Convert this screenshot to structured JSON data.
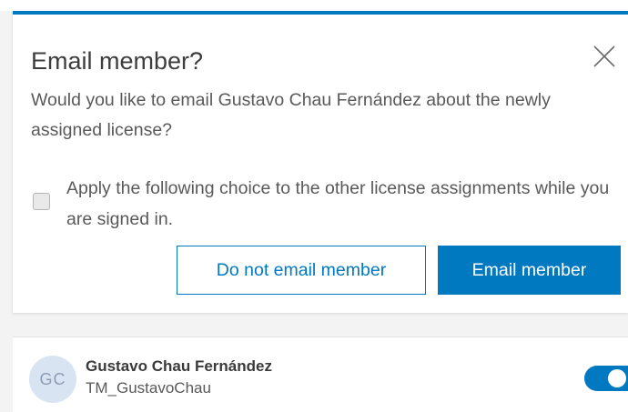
{
  "dialog": {
    "title": "Email member?",
    "message": "Would you like to email Gustavo Chau Fernández about the newly assigned license?",
    "checkbox": {
      "label": "Apply the following choice to the other license assignments while you are signed in.",
      "checked": false
    },
    "secondary_button_label": "Do not email member",
    "primary_button_label": "Email member",
    "close_icon": "close-icon"
  },
  "member": {
    "initials": "GC",
    "name": "Gustavo Chau Fernández",
    "username": "TM_GustavoChau",
    "toggle_on": true
  },
  "colors": {
    "accent": "#0079c1",
    "avatar_bg": "#d9e4f2",
    "avatar_text": "#8e9db3",
    "text": "#595959"
  }
}
